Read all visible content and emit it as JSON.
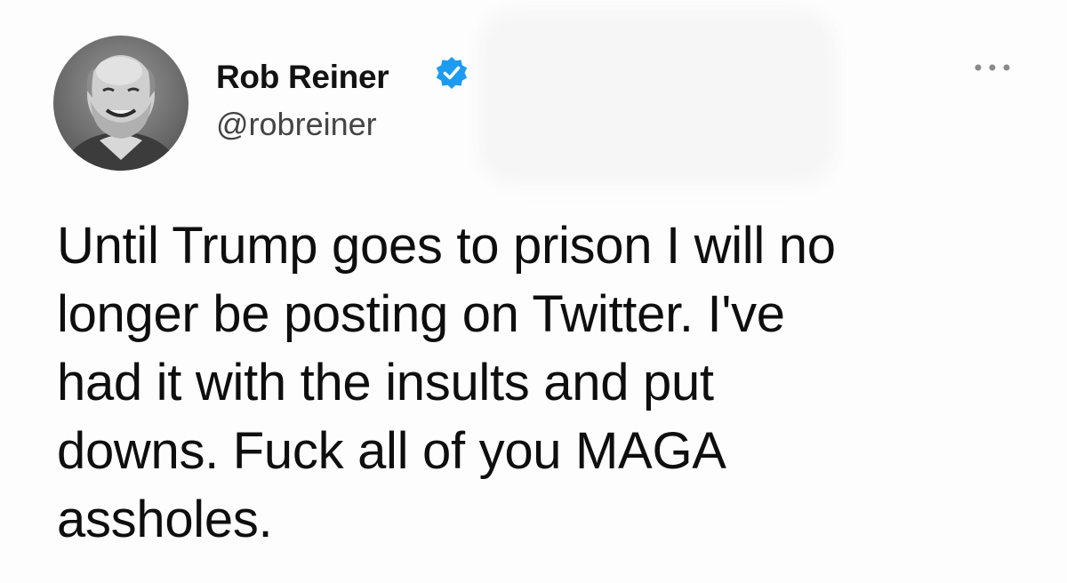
{
  "tweet": {
    "author": {
      "display_name": "Rob Reiner",
      "handle": "@robreiner",
      "verified": true,
      "avatar": "profile-photo"
    },
    "text_lines": [
      "Until Trump goes to prison I will no",
      "longer be posting on Twitter. I've",
      "had it with the insults and put",
      "downs. Fuck all of you MAGA",
      "assholes."
    ],
    "icons": {
      "verified": "verified-badge-icon",
      "more": "more-options-icon"
    }
  },
  "colors": {
    "verified_blue": "#1d9bf0",
    "text": "#0e0e0e",
    "handle": "#444444"
  }
}
